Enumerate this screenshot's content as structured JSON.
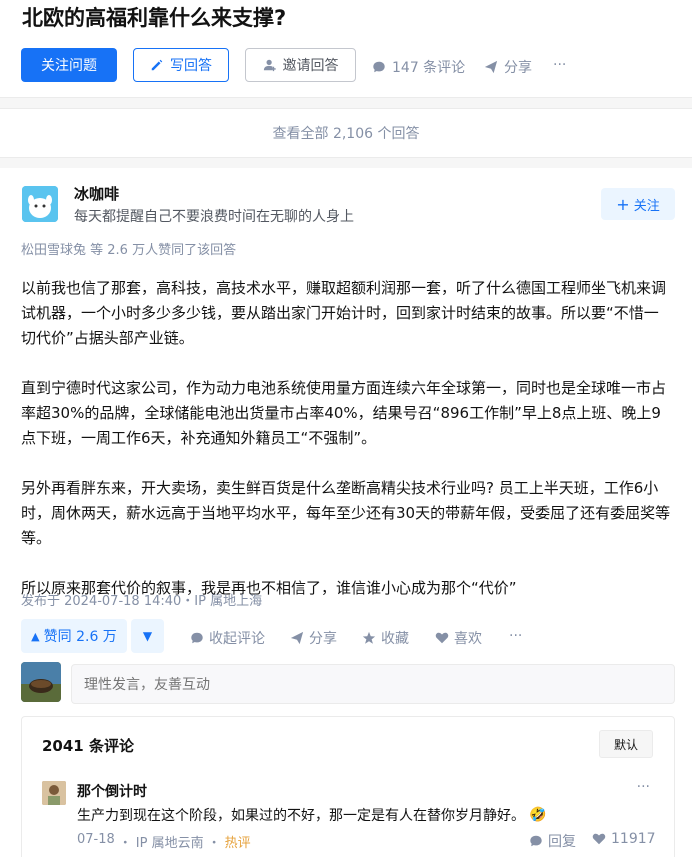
{
  "question": {
    "title": "北欧的高福利靠什么来支撑?",
    "follow_label": "关注问题",
    "write_label": "写回答",
    "invite_label": "邀请回答",
    "comments_label": "147 条评论",
    "share_label": "分享",
    "more_label": "···"
  },
  "view_all_label": "查看全部 2,106 个回答",
  "answer": {
    "author_name": "冰咖啡",
    "author_bio": "每天都提醒自己不要浪费时间在无聊的人身上",
    "follow_label": "关注",
    "voters_text": "松田雪球兔 等 2.6 万人赞同了该回答",
    "paragraphs": [
      "以前我也信了那套，高科技，高技术水平，赚取超额利润那一套，听了什么德国工程师坐飞机来调试机器，一个小时多少多少钱，要从踏出家门开始计时，回到家计时结束的故事。所以要“不惜一切代价”占据头部产业链。",
      "直到宁德时代这家公司，作为动力电池系统使用量方面连续六年全球第一，同时也是全球唯一市占率超30%的品牌，全球储能电池出货量市占率40%，结果号召“896工作制”早上8点上班、晚上9点下班，一周工作6天，补充通知外籍员工“不强制”。",
      "另外再看胖东来，开大卖场，卖生鲜百货是什么垄断高精尖技术行业吗? 员工上半天班，工作6小时，周休两天，薪水远高于当地平均水平，每年至少还有30天的带薪年假，受委屈了还有委屈奖等等。",
      "所以原来那套代价的叙事，我是再也不相信了，谁信谁小心成为那个“代价”"
    ],
    "published": "发布于 2024-07-18 14:40・IP 属地上海",
    "vote_label": "赞同 2.6 万",
    "actions": {
      "collapse_comments": "收起评论",
      "share": "分享",
      "favorite": "收藏",
      "like": "喜欢",
      "more": "···"
    }
  },
  "comment_input": {
    "placeholder": "理性发言，友善互动"
  },
  "comments": {
    "count_label": "2041 条评论",
    "sort_label": "默认",
    "items": [
      {
        "user": "那个倒计时",
        "text": "生产力到现在这个阶段，如果过的不好，那一定是有人在替你岁月静好。",
        "emoji": "🤣",
        "date": "07-18",
        "ip": "IP 属地云南",
        "tag": "热评",
        "reply_label": "回复",
        "likes": "11917"
      }
    ]
  },
  "colors": {
    "primary": "#1772f6",
    "muted": "#8590a6",
    "hot": "#e6a23c"
  }
}
